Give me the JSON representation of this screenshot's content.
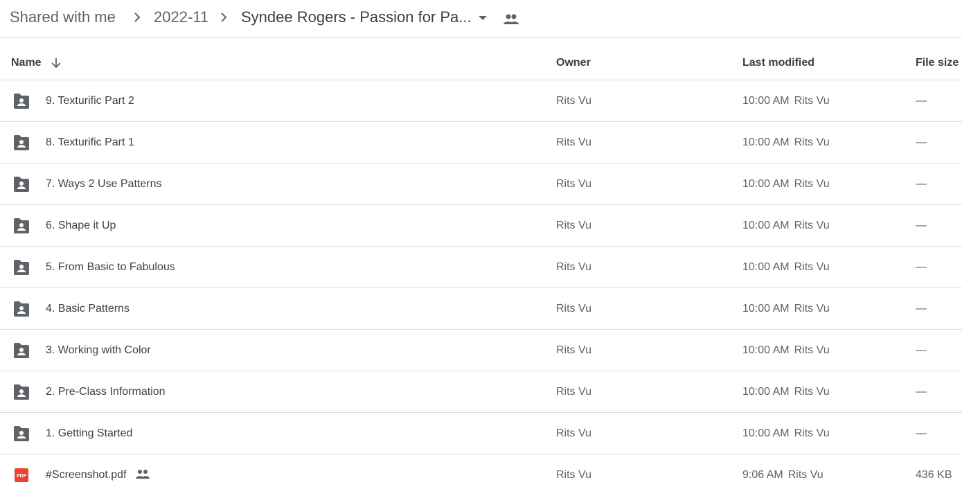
{
  "breadcrumb": {
    "items": [
      "Shared with me",
      "2022-11",
      "Syndee Rogers - Passion for Pa..."
    ]
  },
  "icons": {
    "chevron": "chevron-right-icon",
    "dropdown": "arrow-drop-down-icon",
    "shared": "people-icon",
    "folder": "shared-folder-icon",
    "pdf": "pdf-icon",
    "sort": "arrow-down-icon"
  },
  "colors": {
    "folder": "#5f6368",
    "pdf": "#ea4335",
    "divider": "#dadce0",
    "text": "#3c4043",
    "muted": "#5f6368"
  },
  "table": {
    "columns": {
      "name": "Name",
      "owner": "Owner",
      "modified": "Last modified",
      "size": "File size"
    },
    "rows": [
      {
        "type": "folder",
        "name": "9. Texturific Part 2",
        "owner": "Rits Vu",
        "time": "10:00 AM",
        "modified_by": "Rits Vu",
        "size": "—"
      },
      {
        "type": "folder",
        "name": "8. Texturific Part 1",
        "owner": "Rits Vu",
        "time": "10:00 AM",
        "modified_by": "Rits Vu",
        "size": "—"
      },
      {
        "type": "folder",
        "name": "7. Ways 2 Use Patterns",
        "owner": "Rits Vu",
        "time": "10:00 AM",
        "modified_by": "Rits Vu",
        "size": "—"
      },
      {
        "type": "folder",
        "name": "6. Shape it Up",
        "owner": "Rits Vu",
        "time": "10:00 AM",
        "modified_by": "Rits Vu",
        "size": "—"
      },
      {
        "type": "folder",
        "name": "5. From Basic to Fabulous",
        "owner": "Rits Vu",
        "time": "10:00 AM",
        "modified_by": "Rits Vu",
        "size": "—"
      },
      {
        "type": "folder",
        "name": "4. Basic Patterns",
        "owner": "Rits Vu",
        "time": "10:00 AM",
        "modified_by": "Rits Vu",
        "size": "—"
      },
      {
        "type": "folder",
        "name": "3. Working with Color",
        "owner": "Rits Vu",
        "time": "10:00 AM",
        "modified_by": "Rits Vu",
        "size": "—"
      },
      {
        "type": "folder",
        "name": "2. Pre-Class Information",
        "owner": "Rits Vu",
        "time": "10:00 AM",
        "modified_by": "Rits Vu",
        "size": "—"
      },
      {
        "type": "folder",
        "name": "1. Getting Started",
        "owner": "Rits Vu",
        "time": "10:00 AM",
        "modified_by": "Rits Vu",
        "size": "—"
      },
      {
        "type": "pdf",
        "icon_label": "PDF",
        "name": "#Screenshot.pdf",
        "shared": true,
        "owner": "Rits Vu",
        "time": "9:06 AM",
        "modified_by": "Rits Vu",
        "size": "436 KB"
      }
    ]
  }
}
